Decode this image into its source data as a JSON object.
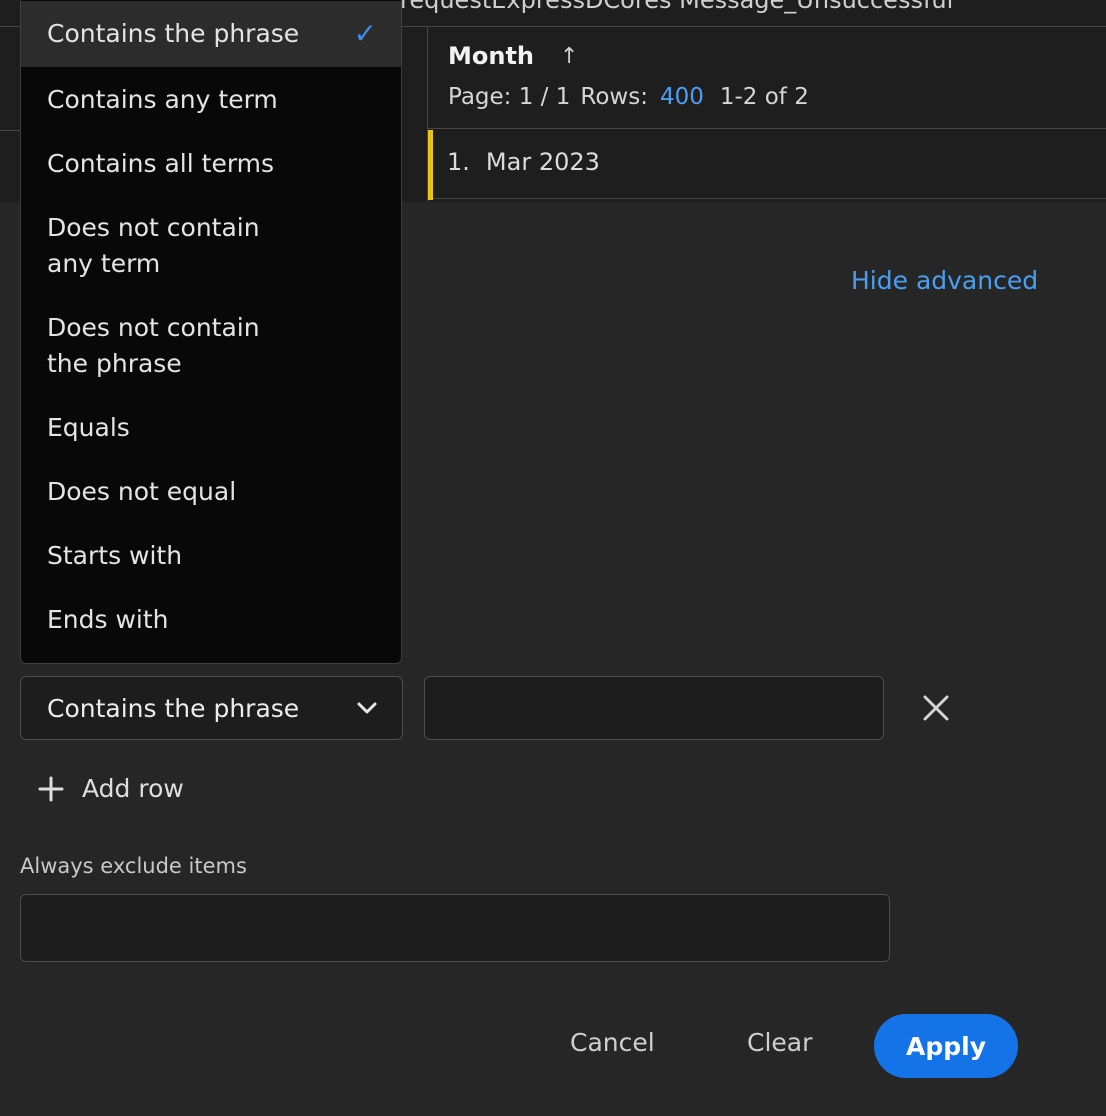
{
  "background": {
    "top_title": "requestExpressDCores Message_Unsuccessful",
    "column_header": "Month",
    "sort_icon": "arrow-up-icon",
    "pagination": {
      "page_label": "Page: 1 / 1",
      "rows_label": "Rows:",
      "rows_value": "400",
      "range": "1-2 of 2"
    },
    "first_row": {
      "index": "1.",
      "value": "Mar 2023"
    }
  },
  "hide_advanced_label": "Hide advanced",
  "dropdown": {
    "selected": "Contains the phrase",
    "options": [
      "Contains the phrase",
      "Contains any term",
      "Contains all terms",
      "Does not contain any term",
      "Does not contain the phrase",
      "Equals",
      "Does not equal",
      "Starts with",
      "Ends with"
    ]
  },
  "condition_row": {
    "operator_value": "Contains the phrase",
    "text_value": ""
  },
  "add_row_label": "Add row",
  "exclude": {
    "label": "Always exclude items",
    "value": ""
  },
  "actions": {
    "cancel": "Cancel",
    "clear": "Clear",
    "apply": "Apply"
  },
  "colors": {
    "accent": "#1473e6",
    "link": "#4a9ff2",
    "row_marker": "#e8c614"
  }
}
